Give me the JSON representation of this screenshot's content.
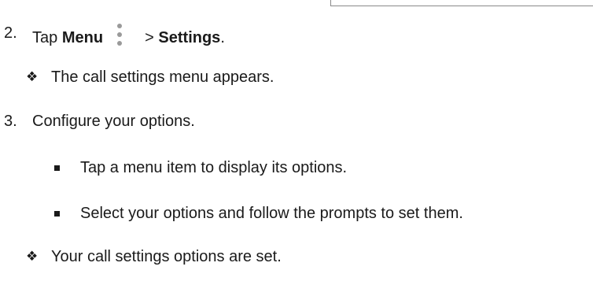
{
  "step2": {
    "number": "2.",
    "prefix": "Tap",
    "menu_label": "Menu",
    "icon": "menu-dots-vertical-icon",
    "separator": ">",
    "settings_label": "Settings",
    "suffix": "."
  },
  "result1": {
    "bullet": "❖",
    "text": "The call settings menu appears."
  },
  "step3": {
    "number": "3.",
    "text": "Configure your options."
  },
  "sub_items": [
    {
      "text": "Tap a menu item to display its options."
    },
    {
      "text": "Select your options and follow the prompts to set them."
    }
  ],
  "result2": {
    "bullet": "❖",
    "text": "Your call settings options are set."
  }
}
